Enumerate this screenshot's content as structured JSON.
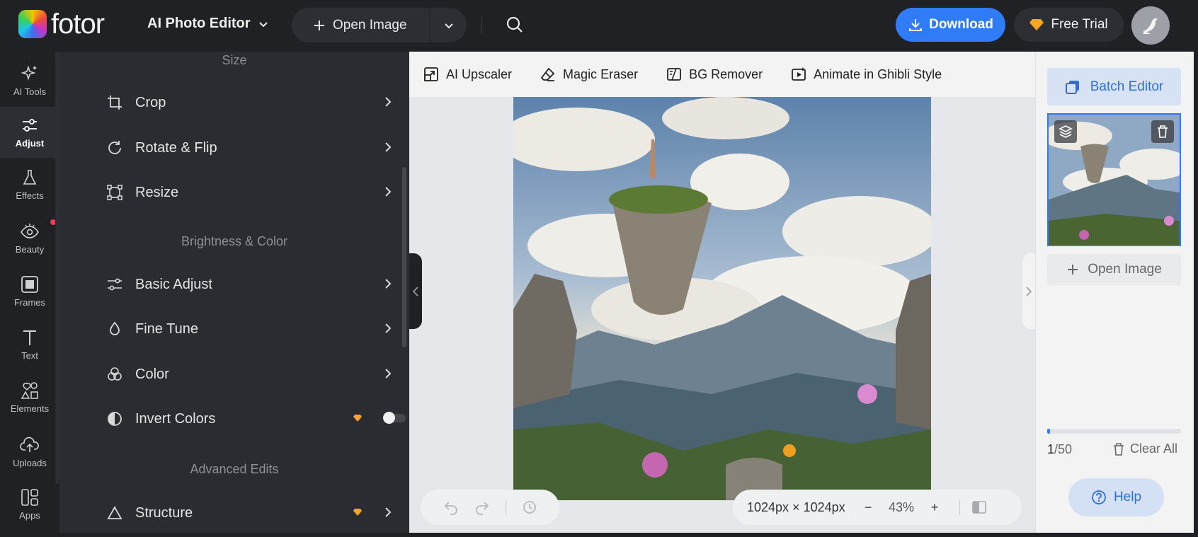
{
  "header": {
    "logo_text": "fotor",
    "app_title": "AI Photo Editor",
    "open_image": "Open Image",
    "download": "Download",
    "free_trial": "Free Trial"
  },
  "leftnav": {
    "items": [
      {
        "label": "AI Tools",
        "icon": "sparkle-icon"
      },
      {
        "label": "Adjust",
        "icon": "sliders-icon",
        "active": true
      },
      {
        "label": "Effects",
        "icon": "flask-icon"
      },
      {
        "label": "Beauty",
        "icon": "eye-icon"
      },
      {
        "label": "Frames",
        "icon": "frame-icon"
      },
      {
        "label": "Text",
        "icon": "text-icon"
      },
      {
        "label": "Elements",
        "icon": "shapes-icon"
      },
      {
        "label": "Uploads",
        "icon": "cloud-upload-icon"
      },
      {
        "label": "Apps",
        "icon": "apps-icon"
      }
    ]
  },
  "panel": {
    "sections": {
      "size": "Size",
      "brightness": "Brightness & Color",
      "advanced": "Advanced Edits"
    },
    "tools": {
      "crop": "Crop",
      "rotate": "Rotate & Flip",
      "resize": "Resize",
      "basic_adjust": "Basic Adjust",
      "fine_tune": "Fine Tune",
      "color": "Color",
      "invert_colors": "Invert Colors",
      "structure": "Structure"
    },
    "invert_enabled": false
  },
  "ai_toolbar": {
    "upscaler": "AI Upscaler",
    "magic_eraser": "Magic Eraser",
    "bg_remover": "BG Remover",
    "ghibli": "Animate in Ghibli Style"
  },
  "canvas": {
    "dimensions": "1024px × 1024px",
    "zoom": "43%",
    "zoom_minus": "−",
    "zoom_plus": "+"
  },
  "right": {
    "batch_editor": "Batch Editor",
    "open_image": "Open Image",
    "count_current": "1",
    "count_total": "/50",
    "progress": 0.02,
    "clear_all": "Clear All",
    "help": "Help"
  },
  "colors": {
    "accent": "#2f7cf6",
    "crown": "#f5a623",
    "notification": "#f23a5a"
  }
}
